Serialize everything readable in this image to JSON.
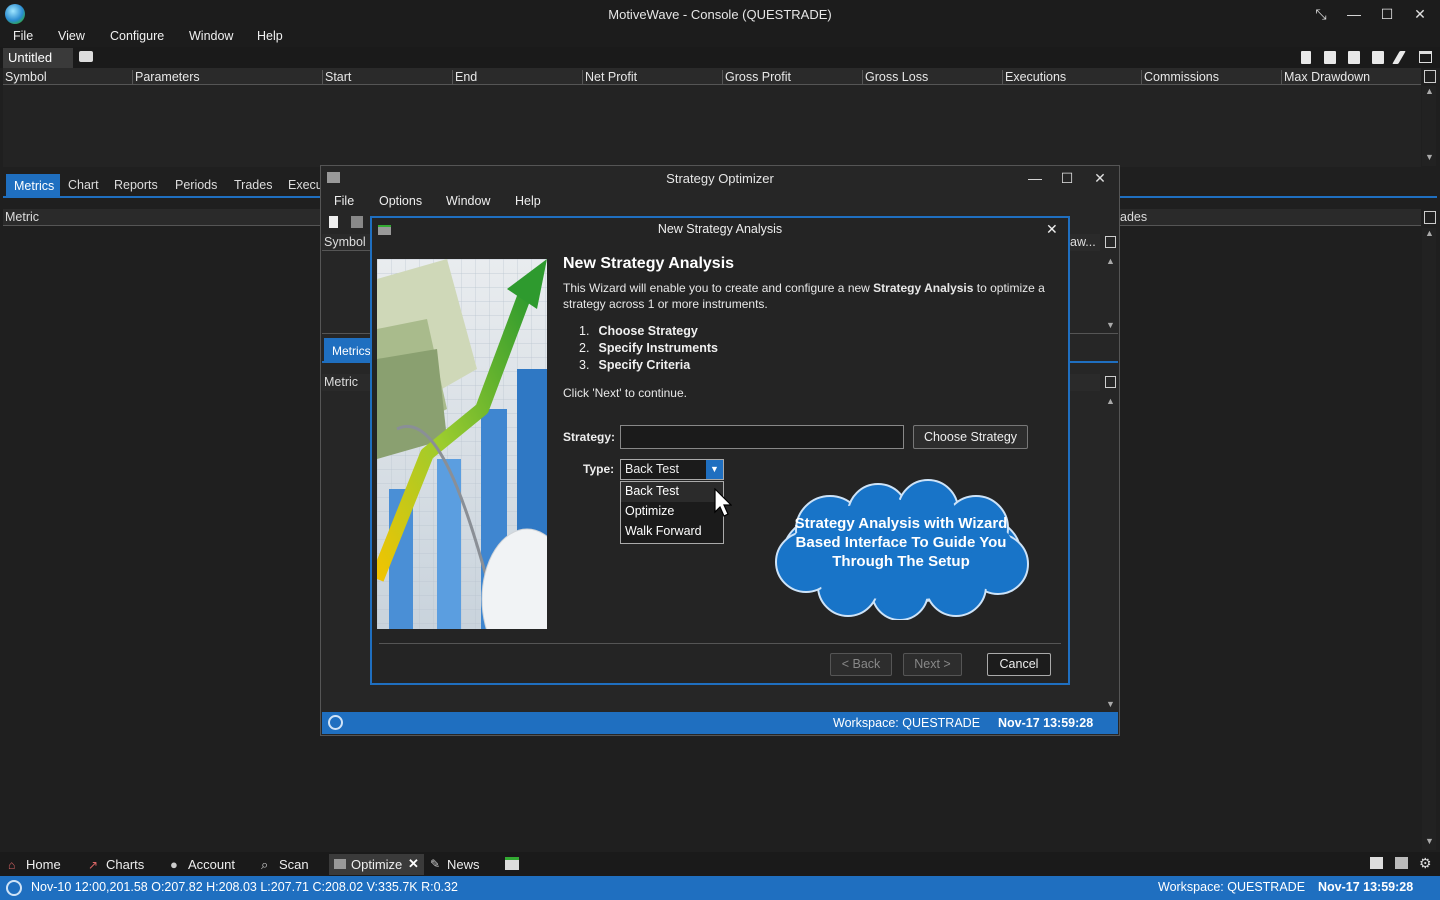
{
  "app": {
    "title": "MotiveWave - Console (QUESTRADE)",
    "menu": [
      "File",
      "View",
      "Configure",
      "Window",
      "Help"
    ],
    "window_controls": [
      "⤡",
      "—",
      "☐",
      "✕"
    ]
  },
  "document_tab": "Untitled",
  "results_table": {
    "columns": [
      "Symbol",
      "Parameters",
      "Start",
      "End",
      "Net Profit",
      "Gross Profit",
      "Gross Loss",
      "Executions",
      "Commissions",
      "Max Drawdown"
    ]
  },
  "lower_panel": {
    "tabs": [
      "Metrics",
      "Chart",
      "Reports",
      "Periods",
      "Trades",
      "Execu"
    ],
    "metric_header": "Metric",
    "right_header_fragment": "ades"
  },
  "optimizer": {
    "title": "Strategy Optimizer",
    "menu": [
      "File",
      "Options",
      "Window",
      "Help"
    ],
    "symbol_header": "Symbol",
    "right_header_fragment": "aw...",
    "metrics_tab": "Metrics",
    "metric_header": "Metric",
    "status_workspace": "Workspace: QUESTRADE",
    "status_time": "Nov-17 13:59:28"
  },
  "dialog": {
    "title": "New Strategy Analysis",
    "heading": "New Strategy Analysis",
    "desc_part1": "This Wizard will enable you to create and configure a new ",
    "desc_bold": "Strategy Analysis",
    "desc_part2": " to optimize a strategy across 1 or more instruments.",
    "steps": [
      {
        "n": "1.",
        "label": "Choose Strategy"
      },
      {
        "n": "2.",
        "label": "Specify Instruments"
      },
      {
        "n": "3.",
        "label": "Specify Criteria"
      }
    ],
    "click_next": "Click 'Next' to continue.",
    "strategy_label": "Strategy:",
    "strategy_value": "",
    "choose_strategy_button": "Choose Strategy",
    "type_label": "Type:",
    "type_selected": "Back Test",
    "type_options": [
      "Back Test",
      "Optimize",
      "Walk Forward"
    ],
    "back_button": "< Back",
    "next_button": "Next >",
    "cancel_button": "Cancel",
    "callout": "Strategy Analysis with Wizard Based Interface To Guide You Through The Setup"
  },
  "bottom_nav": [
    "Home",
    "Charts",
    "Account",
    "Scan",
    "Optimize",
    "News"
  ],
  "status": {
    "quote": "Nov-10 12:00,201.58 O:207.82 H:208.03 L:207.71 C:208.02 V:335.7K R:0.32",
    "workspace": "Workspace: QUESTRADE",
    "time": "Nov-17 13:59:28"
  },
  "colors": {
    "accent": "#1f6fc0",
    "background": "#1f1f1f",
    "cloud": "#1874c8"
  }
}
